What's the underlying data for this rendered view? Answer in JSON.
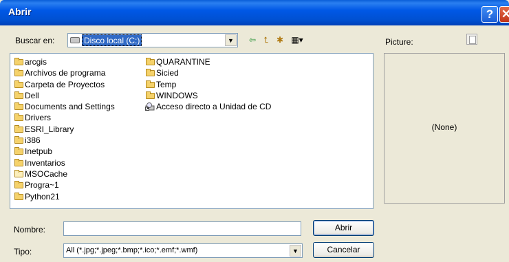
{
  "window": {
    "title": "Abrir"
  },
  "lookin": {
    "label": "Buscar en:",
    "value": "Disco local (C:)"
  },
  "toolbar": {
    "back_icon": "back-arrow-icon",
    "up_icon": "up-folder-icon",
    "new_icon": "new-folder-icon",
    "views_icon": "views-menu-icon"
  },
  "files": {
    "col1": [
      "arcgis",
      "Archivos de programa",
      "Carpeta de Proyectos",
      "Dell",
      "Documents and Settings",
      "Drivers",
      "ESRI_Library",
      "i386",
      "Inetpub",
      "Inventarios",
      "MSOCache",
      "Progra~1",
      "Python21"
    ],
    "col2": [
      "QUARANTINE",
      "Sicied",
      "Temp",
      "WINDOWS",
      "Acceso directo a Unidad de CD"
    ]
  },
  "preview": {
    "label": "Picture:",
    "none_text": "(None)"
  },
  "filename": {
    "label": "Nombre:",
    "value": ""
  },
  "filetype": {
    "label": "Tipo:",
    "value": "All (*.jpg;*.jpeg;*.bmp;*.ico;*.emf;*.wmf)"
  },
  "buttons": {
    "open": "Abrir",
    "cancel": "Cancelar"
  }
}
